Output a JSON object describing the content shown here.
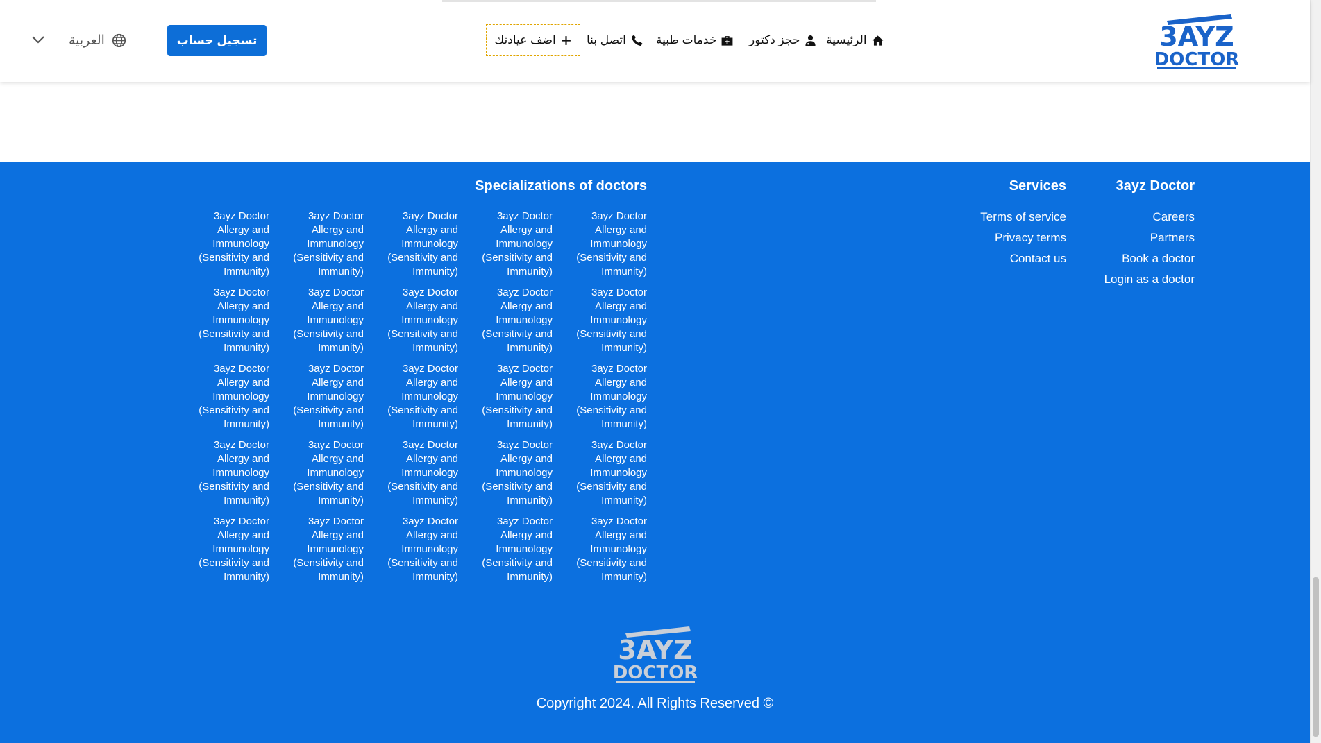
{
  "header": {
    "logo_text": [
      "3AYZ",
      "DOCTOR"
    ],
    "nav": [
      {
        "label": "الرئيسية",
        "icon": "home-icon"
      },
      {
        "label": "حجز دكتور",
        "icon": "doctor-icon"
      },
      {
        "label": "خدمات طبية",
        "icon": "medical-kit-icon"
      },
      {
        "label": "اتصل بنا",
        "icon": "phone-icon"
      }
    ],
    "add_clinic_label": "اضف عيادتك",
    "signup_label": "تسجيل حساب",
    "language_label": "العربية"
  },
  "footer": {
    "col_3ayz": {
      "title": "3ayz Doctor",
      "links": [
        "Careers",
        "Partners",
        "Book a doctor",
        "Login as a doctor"
      ]
    },
    "col_services": {
      "title": "Services",
      "links": [
        "Terms of service",
        "Privacy terms",
        "Contact us"
      ]
    },
    "specializations": {
      "title": "Specializations of doctors",
      "item_lines": [
        "3ayz Doctor",
        "Allergy and",
        "Immunology",
        "(Sensitivity and",
        "Immunity)"
      ],
      "rows": 5,
      "cols": 5
    },
    "logo_text": [
      "3AYZ",
      "DOCTOR"
    ],
    "copyright": "Copyright 2024. All Rights Reserved ©"
  },
  "colors": {
    "brand_blue": "#0c70df",
    "button_blue": "#0d6ed7",
    "logo_blue": "#1a63c9",
    "footer_logo_gray": "#c9cfd8"
  }
}
